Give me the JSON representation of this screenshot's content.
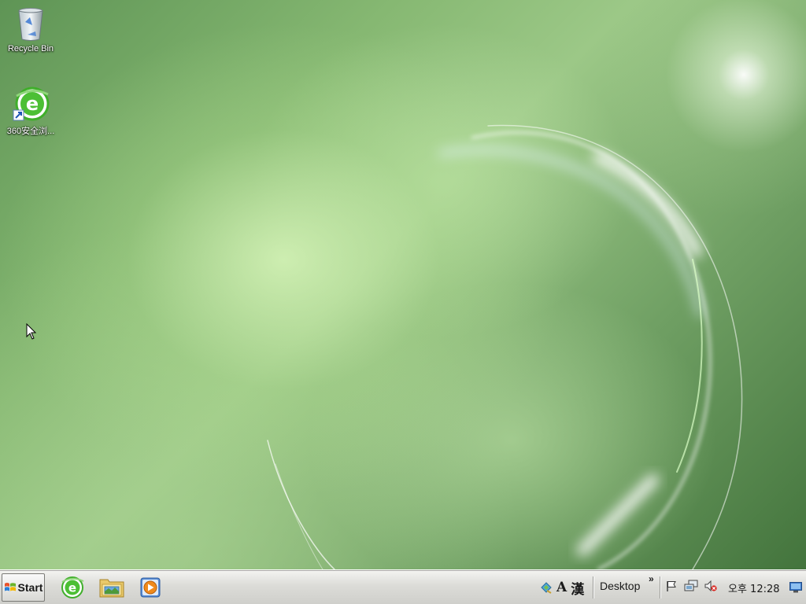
{
  "desktop": {
    "icons": [
      {
        "label": "Recycle Bin",
        "icon": "recycle-bin-icon"
      },
      {
        "label": "360安全浏...",
        "icon": "360-browser-shortcut-icon"
      }
    ]
  },
  "taskbar": {
    "start_label": "Start",
    "quick_launch": [
      {
        "icon": "360-browser-icon"
      },
      {
        "icon": "file-explorer-icon"
      },
      {
        "icon": "media-player-icon"
      }
    ],
    "language_bar": {
      "mode_a": "A",
      "mode_han": "漢"
    },
    "desktop_toolbar_label": "Desktop",
    "overflow_chevron": "»",
    "tray_icons": [
      "action-center-flag-icon",
      "network-icon",
      "volume-muted-icon"
    ],
    "clock": "오후 12:28"
  },
  "colors": {
    "wallpaper_green": "#86b872",
    "taskbar_bg": "#dcdcd8",
    "browser_green": "#3fae2a"
  }
}
